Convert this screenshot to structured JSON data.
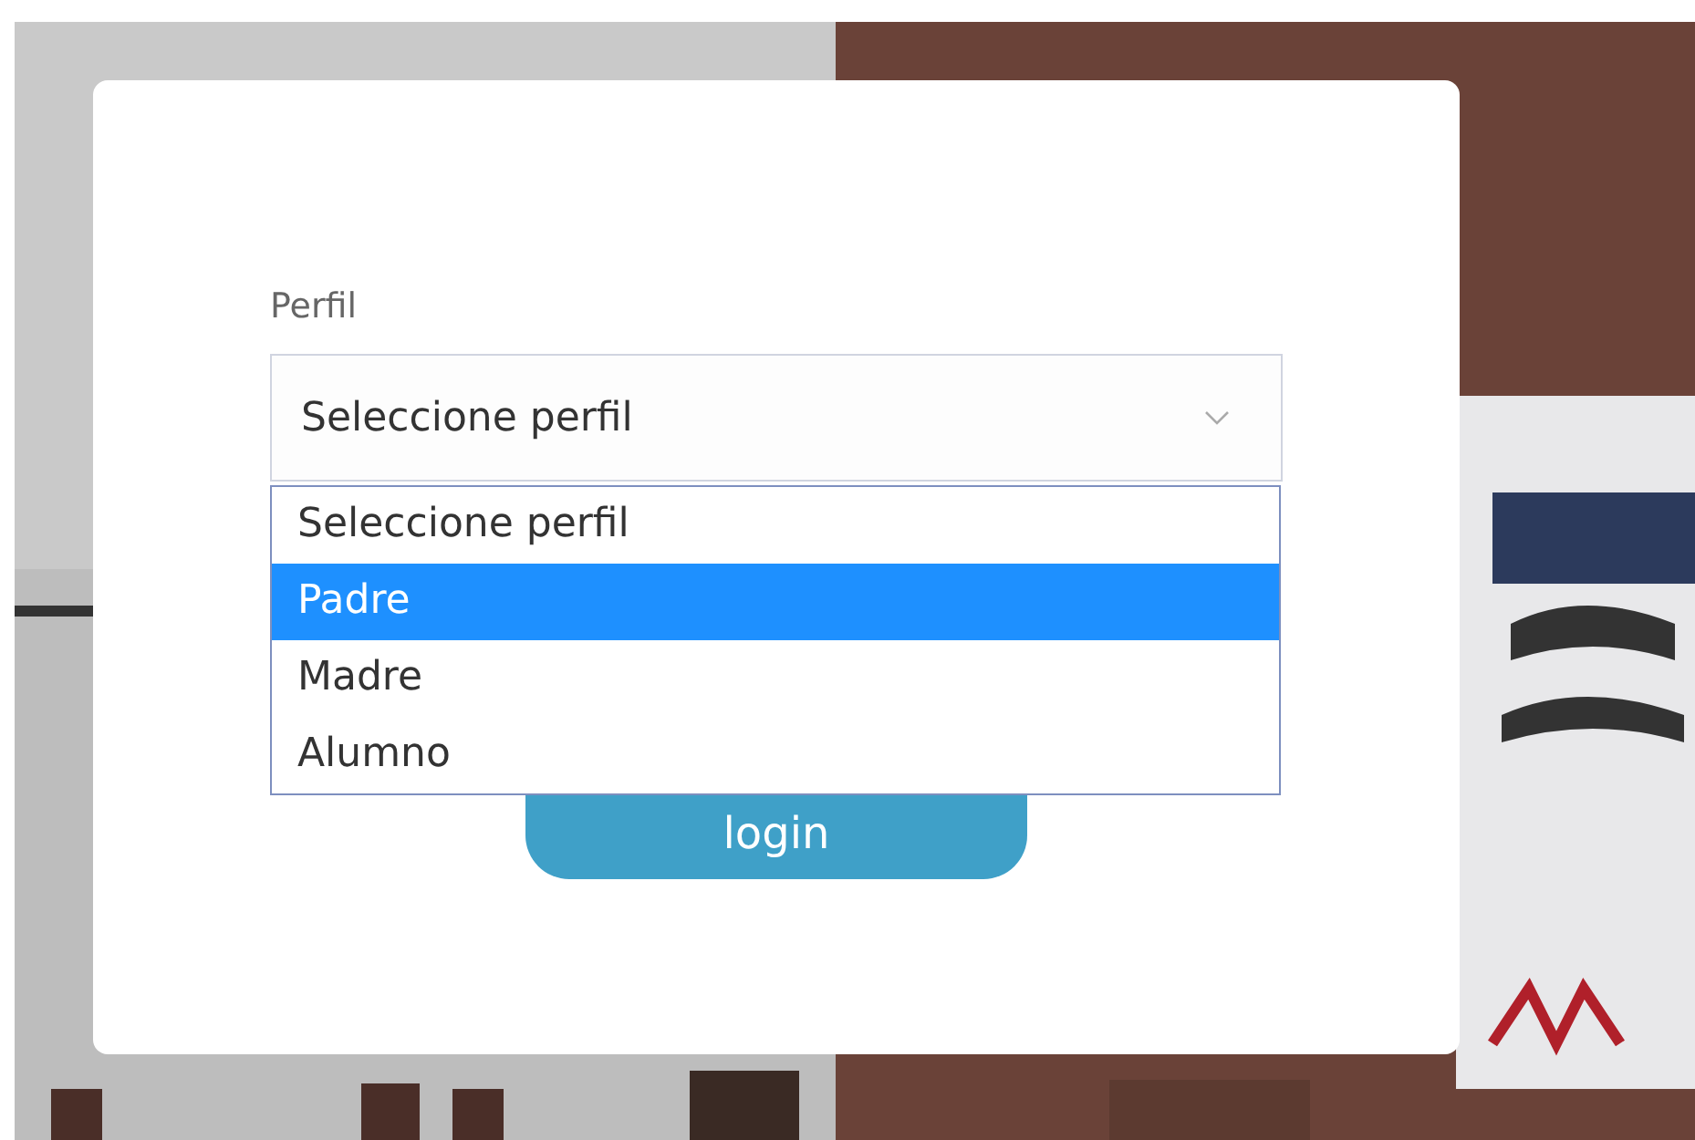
{
  "form": {
    "label": "Perfil",
    "select": {
      "value": "Seleccione perfil",
      "expanded": true,
      "options": [
        {
          "label": "Seleccione perfil",
          "highlighted": false
        },
        {
          "label": "Padre",
          "highlighted": true
        },
        {
          "label": "Madre",
          "highlighted": false
        },
        {
          "label": "Alumno",
          "highlighted": false
        }
      ]
    },
    "login_button": "login"
  }
}
